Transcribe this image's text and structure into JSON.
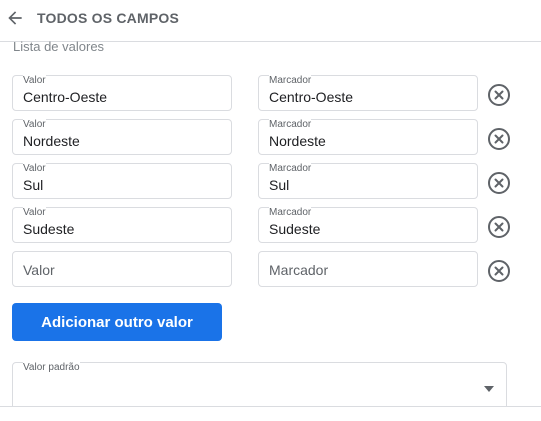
{
  "header": {
    "title": "TODOS OS CAMPOS",
    "back_icon": "arrow-back-icon"
  },
  "section": {
    "label": "Lista de valores"
  },
  "rows": [
    {
      "value_label": "Valor",
      "value": "Centro-Oeste",
      "marker_label": "Marcador",
      "marker": "Centro-Oeste",
      "remove_icon": "close-circle-icon"
    },
    {
      "value_label": "Valor",
      "value": "Nordeste",
      "marker_label": "Marcador",
      "marker": "Nordeste",
      "remove_icon": "close-circle-icon"
    },
    {
      "value_label": "Valor",
      "value": "Sul",
      "marker_label": "Marcador",
      "marker": "Sul",
      "remove_icon": "close-circle-icon"
    },
    {
      "value_label": "Valor",
      "value": "Sudeste",
      "marker_label": "Marcador",
      "marker": "Sudeste",
      "remove_icon": "close-circle-icon"
    }
  ],
  "empty_row": {
    "value_placeholder": "Valor",
    "marker_placeholder": "Marcador",
    "remove_icon": "close-circle-icon"
  },
  "add_button": {
    "label": "Adicionar outro valor"
  },
  "default_value": {
    "label": "Valor padrão",
    "value": "",
    "dropdown_icon": "triangle-down-icon"
  },
  "colors": {
    "accent": "#1a73e8",
    "border": "#dadce0",
    "text_secondary": "#5f6368"
  }
}
